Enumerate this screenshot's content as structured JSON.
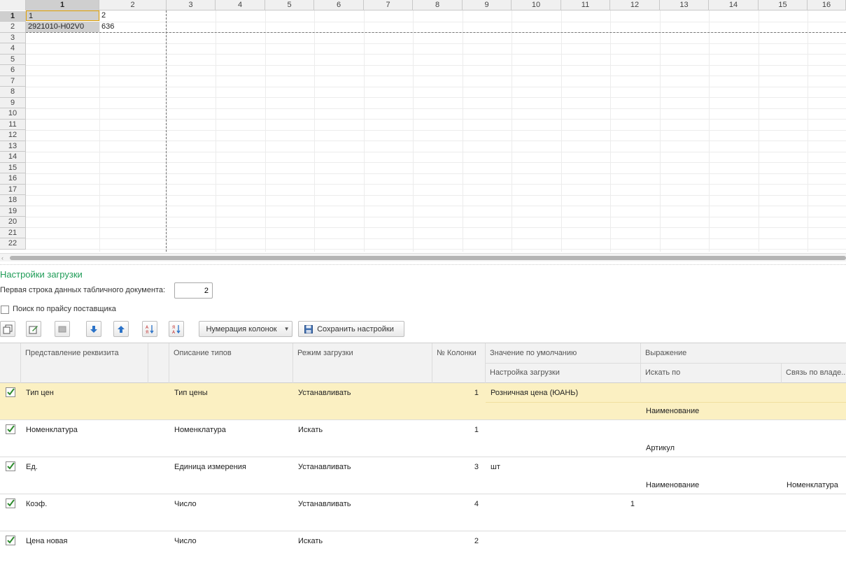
{
  "sheet": {
    "columns": [
      "1",
      "2",
      "3",
      "4",
      "5",
      "6",
      "7",
      "8",
      "9",
      "10",
      "11",
      "12",
      "13",
      "14",
      "15",
      "16"
    ],
    "rows": [
      "1",
      "2",
      "3",
      "4",
      "5",
      "6",
      "7",
      "8",
      "9",
      "10",
      "11",
      "12",
      "13",
      "14",
      "15",
      "16",
      "17",
      "18",
      "19",
      "20",
      "21",
      "22"
    ],
    "cells": {
      "a1": "1",
      "b1": "2",
      "a2": "2921010-H02V0",
      "b2": "636"
    }
  },
  "settings": {
    "title": "Настройки загрузки",
    "first_row_label": "Первая строка данных табличного документа:",
    "first_row_value": "2",
    "search_checkbox_label": "Поиск по прайсу поставщика"
  },
  "toolbar": {
    "numbering_label": "Нумерация колонок",
    "save_label": "Сохранить настройки",
    "icons": [
      "copy-icon",
      "edit-icon",
      "delete-icon",
      "move-down-icon",
      "move-up-icon",
      "sort-asc-icon",
      "sort-desc-icon"
    ]
  },
  "grid": {
    "headers": {
      "attribute": "Представление реквизита",
      "types": "Описание типов",
      "mode": "Режим загрузки",
      "column_no": "№ Колонки",
      "default_value": "Значение по умолчанию",
      "load_setting": "Настройка загрузки",
      "expression": "Выражение",
      "search_by": "Искать по",
      "owner_link": "Связь по владе..."
    },
    "rows": [
      {
        "checked": true,
        "attribute": "Тип цен",
        "types": "Тип цены",
        "mode": "Устанавливать",
        "column_no": "1",
        "default_value": "Розничная цена (ЮАНЬ)",
        "load_setting": "",
        "search_by": "Наименование",
        "owner_link": ""
      },
      {
        "checked": true,
        "attribute": "Номенклатура",
        "types": "Номенклатура",
        "mode": "Искать",
        "column_no": "1",
        "default_value": "",
        "load_setting": "",
        "search_by": "Артикул",
        "owner_link": ""
      },
      {
        "checked": true,
        "attribute": "Ед.",
        "types": "Единица измерения",
        "mode": "Устанавливать",
        "column_no": "3",
        "default_value": "шт",
        "load_setting": "",
        "search_by": "Наименование",
        "owner_link": "Номенклатура"
      },
      {
        "checked": true,
        "attribute": "Коэф.",
        "types": "Число",
        "mode": "Устанавливать",
        "column_no": "4",
        "default_value": "1",
        "load_setting": "",
        "search_by": "",
        "owner_link": ""
      },
      {
        "checked": true,
        "attribute": "Цена новая",
        "types": "Число",
        "mode": "Искать",
        "column_no": "2",
        "default_value": "",
        "load_setting": "",
        "search_by": "",
        "owner_link": ""
      }
    ]
  },
  "colors": {
    "accent_green": "#1f9c57",
    "selected_row": "#fbf0c2",
    "check_green": "#2e8b2e"
  }
}
